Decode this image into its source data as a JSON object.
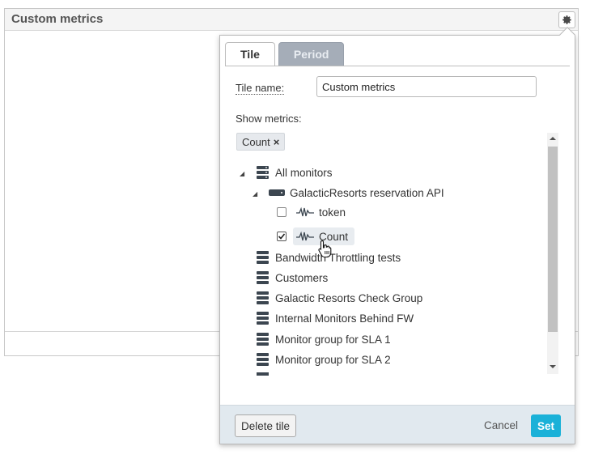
{
  "tile": {
    "title": "Custom metrics"
  },
  "popup": {
    "tabs": [
      {
        "label": "Tile",
        "active": true
      },
      {
        "label": "Period",
        "active": false
      }
    ],
    "tile_name_label": "Tile name:",
    "tile_name_value": "Custom metrics",
    "show_metrics_label": "Show metrics:",
    "selected_chips": [
      {
        "label": "Count",
        "remove": "×"
      }
    ],
    "tree": [
      {
        "label": "All monitors",
        "type": "group",
        "expanded": true
      },
      {
        "label": "GalacticResorts reservation API",
        "type": "monitor",
        "expanded": true
      },
      {
        "label": "token",
        "type": "metric",
        "checked": false
      },
      {
        "label": "Count",
        "type": "metric",
        "checked": true
      },
      {
        "label": "Bandwidth Throttling tests",
        "type": "group"
      },
      {
        "label": "Customers",
        "type": "group"
      },
      {
        "label": "Galactic Resorts Check Group",
        "type": "group"
      },
      {
        "label": "Internal Monitors Behind FW",
        "type": "group"
      },
      {
        "label": "Monitor group for SLA 1",
        "type": "group"
      },
      {
        "label": "Monitor group for SLA 2",
        "type": "group"
      }
    ],
    "footer": {
      "delete_label": "Delete tile",
      "cancel_label": "Cancel",
      "set_label": "Set"
    }
  },
  "colors": {
    "accent": "#1ab1d8",
    "inactive_tab": "#a5adb8",
    "footer_bg": "#e1e9ef",
    "icon_dark": "#3c4650"
  }
}
